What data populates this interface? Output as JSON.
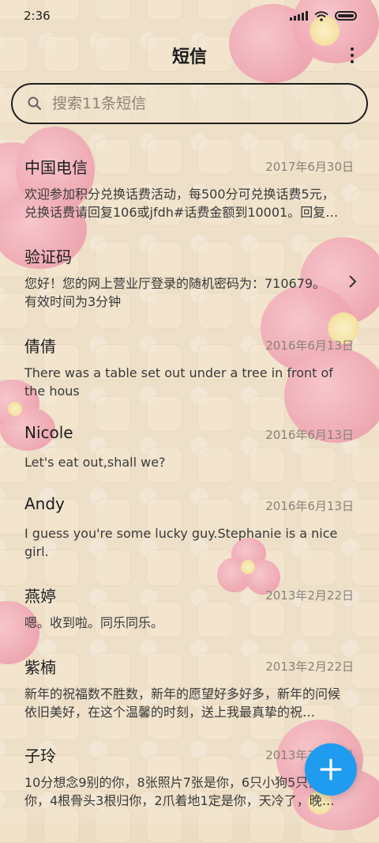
{
  "status_bar": {
    "time": "2:36",
    "icons": [
      "signal-icon",
      "wifi-icon",
      "battery-icon"
    ]
  },
  "header": {
    "title": "短信",
    "more_icon": "more-vertical-icon"
  },
  "search": {
    "placeholder": "搜索11条短信",
    "value": "",
    "icon": "search-icon"
  },
  "conversations": [
    {
      "name": "中国电信",
      "date": "2017年6月30日",
      "preview": "欢迎参加积分兑换话费活动，每500分可兑换话费5元，兑换话费请回复106或jfdh#话费金额到10001。回复…"
    },
    {
      "name": "验证码",
      "date": "",
      "preview": "您好！您的网上营业厅登录的随机密码为：710679。有效时间为3分钟",
      "chevron_icon": "chevron-right-icon"
    },
    {
      "name": "倩倩",
      "date": "2016年6月13日",
      "preview": "There was a table set out under a tree in front of the hous"
    },
    {
      "name": "Nicole",
      "date": "2016年6月13日",
      "preview": "Let's eat out,shall we?"
    },
    {
      "name": "Andy",
      "date": "2016年6月13日",
      "preview": "I guess you're some lucky guy.Stephanie is a nice girl."
    },
    {
      "name": "燕婷",
      "date": "2013年2月22日",
      "preview": "嗯。收到啦。同乐同乐。"
    },
    {
      "name": "紫楠",
      "date": "2013年2月22日",
      "preview": "新年的祝福数不胜数，新年的愿望好多好多，新年的问候依旧美好，在这个温馨的时刻，送上我最真挚的祝…"
    },
    {
      "name": "子玲",
      "date": "2013年2月22日",
      "preview": "10分想念9别的你，8张照片7张是你，6只小狗5只像你，4根骨头3根归你，2爪着地1定是你，天冷了，晚上记…"
    }
  ],
  "fab": {
    "icon": "plus-icon"
  },
  "colors": {
    "accent": "#1f9bf0",
    "background": "#ecdcc2",
    "flower": "#eea3b0"
  }
}
